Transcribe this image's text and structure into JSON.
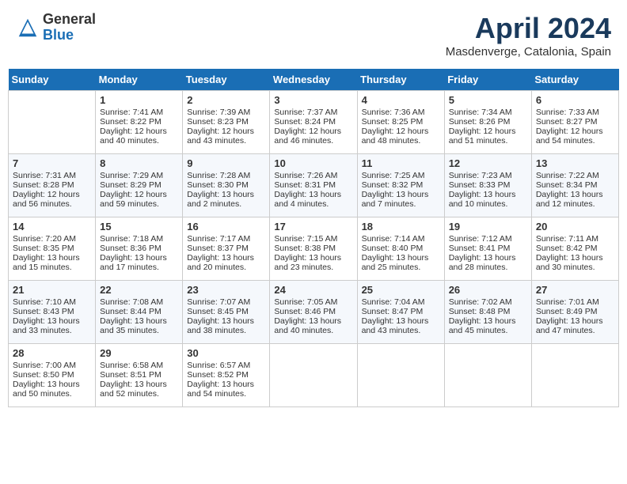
{
  "header": {
    "logo_general": "General",
    "logo_blue": "Blue",
    "month_title": "April 2024",
    "location": "Masdenverge, Catalonia, Spain"
  },
  "days_of_week": [
    "Sunday",
    "Monday",
    "Tuesday",
    "Wednesday",
    "Thursday",
    "Friday",
    "Saturday"
  ],
  "weeks": [
    [
      {
        "day": "",
        "sunrise": "",
        "sunset": "",
        "daylight": ""
      },
      {
        "day": "1",
        "sunrise": "Sunrise: 7:41 AM",
        "sunset": "Sunset: 8:22 PM",
        "daylight": "Daylight: 12 hours and 40 minutes."
      },
      {
        "day": "2",
        "sunrise": "Sunrise: 7:39 AM",
        "sunset": "Sunset: 8:23 PM",
        "daylight": "Daylight: 12 hours and 43 minutes."
      },
      {
        "day": "3",
        "sunrise": "Sunrise: 7:37 AM",
        "sunset": "Sunset: 8:24 PM",
        "daylight": "Daylight: 12 hours and 46 minutes."
      },
      {
        "day": "4",
        "sunrise": "Sunrise: 7:36 AM",
        "sunset": "Sunset: 8:25 PM",
        "daylight": "Daylight: 12 hours and 48 minutes."
      },
      {
        "day": "5",
        "sunrise": "Sunrise: 7:34 AM",
        "sunset": "Sunset: 8:26 PM",
        "daylight": "Daylight: 12 hours and 51 minutes."
      },
      {
        "day": "6",
        "sunrise": "Sunrise: 7:33 AM",
        "sunset": "Sunset: 8:27 PM",
        "daylight": "Daylight: 12 hours and 54 minutes."
      }
    ],
    [
      {
        "day": "7",
        "sunrise": "Sunrise: 7:31 AM",
        "sunset": "Sunset: 8:28 PM",
        "daylight": "Daylight: 12 hours and 56 minutes."
      },
      {
        "day": "8",
        "sunrise": "Sunrise: 7:29 AM",
        "sunset": "Sunset: 8:29 PM",
        "daylight": "Daylight: 12 hours and 59 minutes."
      },
      {
        "day": "9",
        "sunrise": "Sunrise: 7:28 AM",
        "sunset": "Sunset: 8:30 PM",
        "daylight": "Daylight: 13 hours and 2 minutes."
      },
      {
        "day": "10",
        "sunrise": "Sunrise: 7:26 AM",
        "sunset": "Sunset: 8:31 PM",
        "daylight": "Daylight: 13 hours and 4 minutes."
      },
      {
        "day": "11",
        "sunrise": "Sunrise: 7:25 AM",
        "sunset": "Sunset: 8:32 PM",
        "daylight": "Daylight: 13 hours and 7 minutes."
      },
      {
        "day": "12",
        "sunrise": "Sunrise: 7:23 AM",
        "sunset": "Sunset: 8:33 PM",
        "daylight": "Daylight: 13 hours and 10 minutes."
      },
      {
        "day": "13",
        "sunrise": "Sunrise: 7:22 AM",
        "sunset": "Sunset: 8:34 PM",
        "daylight": "Daylight: 13 hours and 12 minutes."
      }
    ],
    [
      {
        "day": "14",
        "sunrise": "Sunrise: 7:20 AM",
        "sunset": "Sunset: 8:35 PM",
        "daylight": "Daylight: 13 hours and 15 minutes."
      },
      {
        "day": "15",
        "sunrise": "Sunrise: 7:18 AM",
        "sunset": "Sunset: 8:36 PM",
        "daylight": "Daylight: 13 hours and 17 minutes."
      },
      {
        "day": "16",
        "sunrise": "Sunrise: 7:17 AM",
        "sunset": "Sunset: 8:37 PM",
        "daylight": "Daylight: 13 hours and 20 minutes."
      },
      {
        "day": "17",
        "sunrise": "Sunrise: 7:15 AM",
        "sunset": "Sunset: 8:38 PM",
        "daylight": "Daylight: 13 hours and 23 minutes."
      },
      {
        "day": "18",
        "sunrise": "Sunrise: 7:14 AM",
        "sunset": "Sunset: 8:40 PM",
        "daylight": "Daylight: 13 hours and 25 minutes."
      },
      {
        "day": "19",
        "sunrise": "Sunrise: 7:12 AM",
        "sunset": "Sunset: 8:41 PM",
        "daylight": "Daylight: 13 hours and 28 minutes."
      },
      {
        "day": "20",
        "sunrise": "Sunrise: 7:11 AM",
        "sunset": "Sunset: 8:42 PM",
        "daylight": "Daylight: 13 hours and 30 minutes."
      }
    ],
    [
      {
        "day": "21",
        "sunrise": "Sunrise: 7:10 AM",
        "sunset": "Sunset: 8:43 PM",
        "daylight": "Daylight: 13 hours and 33 minutes."
      },
      {
        "day": "22",
        "sunrise": "Sunrise: 7:08 AM",
        "sunset": "Sunset: 8:44 PM",
        "daylight": "Daylight: 13 hours and 35 minutes."
      },
      {
        "day": "23",
        "sunrise": "Sunrise: 7:07 AM",
        "sunset": "Sunset: 8:45 PM",
        "daylight": "Daylight: 13 hours and 38 minutes."
      },
      {
        "day": "24",
        "sunrise": "Sunrise: 7:05 AM",
        "sunset": "Sunset: 8:46 PM",
        "daylight": "Daylight: 13 hours and 40 minutes."
      },
      {
        "day": "25",
        "sunrise": "Sunrise: 7:04 AM",
        "sunset": "Sunset: 8:47 PM",
        "daylight": "Daylight: 13 hours and 43 minutes."
      },
      {
        "day": "26",
        "sunrise": "Sunrise: 7:02 AM",
        "sunset": "Sunset: 8:48 PM",
        "daylight": "Daylight: 13 hours and 45 minutes."
      },
      {
        "day": "27",
        "sunrise": "Sunrise: 7:01 AM",
        "sunset": "Sunset: 8:49 PM",
        "daylight": "Daylight: 13 hours and 47 minutes."
      }
    ],
    [
      {
        "day": "28",
        "sunrise": "Sunrise: 7:00 AM",
        "sunset": "Sunset: 8:50 PM",
        "daylight": "Daylight: 13 hours and 50 minutes."
      },
      {
        "day": "29",
        "sunrise": "Sunrise: 6:58 AM",
        "sunset": "Sunset: 8:51 PM",
        "daylight": "Daylight: 13 hours and 52 minutes."
      },
      {
        "day": "30",
        "sunrise": "Sunrise: 6:57 AM",
        "sunset": "Sunset: 8:52 PM",
        "daylight": "Daylight: 13 hours and 54 minutes."
      },
      {
        "day": "",
        "sunrise": "",
        "sunset": "",
        "daylight": ""
      },
      {
        "day": "",
        "sunrise": "",
        "sunset": "",
        "daylight": ""
      },
      {
        "day": "",
        "sunrise": "",
        "sunset": "",
        "daylight": ""
      },
      {
        "day": "",
        "sunrise": "",
        "sunset": "",
        "daylight": ""
      }
    ]
  ]
}
